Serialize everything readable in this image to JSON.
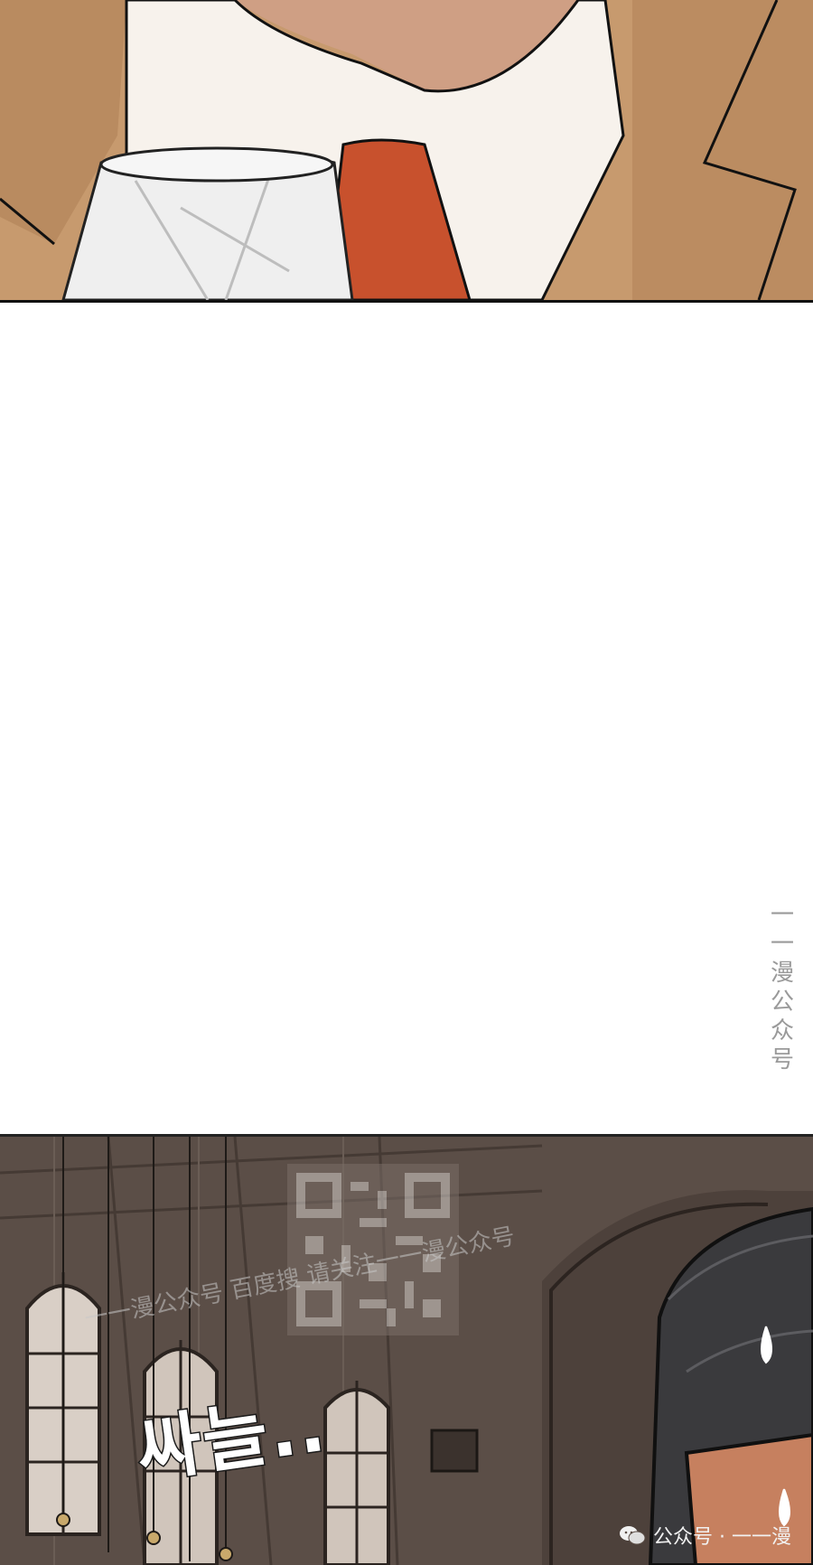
{
  "panels": {
    "bottom": {
      "sfx_text": "싸늘..",
      "diagonal_watermark": "一一漫公众号 百度搜 请关注一一漫公众号"
    }
  },
  "vertical_watermark": [
    "一",
    "一",
    "漫",
    "公",
    "众",
    "号"
  ],
  "footer_watermark": {
    "icon": "wechat-icon",
    "label": "公众号 · 一一漫"
  },
  "colors": {
    "jacket": "#c79a6e",
    "tie": "#c8512d",
    "shirt": "#fbf8f3",
    "room": "#5b4e47"
  }
}
